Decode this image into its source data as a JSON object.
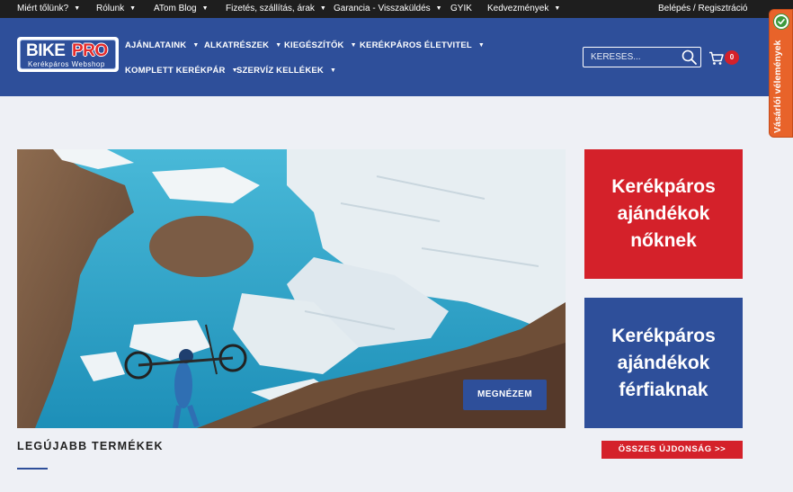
{
  "topbar": {
    "items": [
      {
        "label": "Miért tőlünk?",
        "has_dropdown": true
      },
      {
        "label": "Rólunk",
        "has_dropdown": true
      },
      {
        "label": "ATom Blog",
        "has_dropdown": true
      },
      {
        "label": "Fizetés, szállítás, árak",
        "has_dropdown": true
      },
      {
        "label": "Garancia - Visszaküldés",
        "has_dropdown": true
      },
      {
        "label": "GYIK",
        "has_dropdown": false
      },
      {
        "label": "Kedvezmények",
        "has_dropdown": true
      }
    ],
    "login_label": "Belépés / Regisztráció"
  },
  "logo": {
    "word1": "BIKE",
    "word2": "PRO",
    "subtitle": "Kerékpáros Webshop"
  },
  "nav": {
    "items": [
      {
        "label": "AJÁNLATAINK"
      },
      {
        "label": "ALKATRÉSZEK"
      },
      {
        "label": "KIEGÉSZÍTŐK"
      },
      {
        "label": "KERÉKPÁROS ÉLETVITEL"
      },
      {
        "label": "KOMPLETT KERÉKPÁR"
      },
      {
        "label": "SZERVÍZ KELLÉKEK"
      }
    ]
  },
  "search": {
    "placeholder": "KERESÉS..."
  },
  "cart": {
    "count": "0",
    "icon": "cart-icon"
  },
  "feedback": {
    "label": "Vásárlói vélemények",
    "icon": "check-badge-icon"
  },
  "hero": {
    "cta_label": "MEGNÉZEM"
  },
  "promos": {
    "women": {
      "lines": [
        "Kerékpáros",
        "ajándékok",
        "nőknek"
      ]
    },
    "men": {
      "lines": [
        "Kerékpáros",
        "ajándékok",
        "férfiaknak"
      ]
    }
  },
  "newest": {
    "title": "LEGÚJABB TERMÉKEK",
    "all_label": "ÖSSZES ÚJDONSÁG >>"
  },
  "colors": {
    "brand_blue": "#2e4f9a",
    "brand_red": "#d4212a",
    "topbar_bg": "#1e1e1e",
    "page_bg": "#eef0f5",
    "feedback_orange": "#e8632a"
  }
}
